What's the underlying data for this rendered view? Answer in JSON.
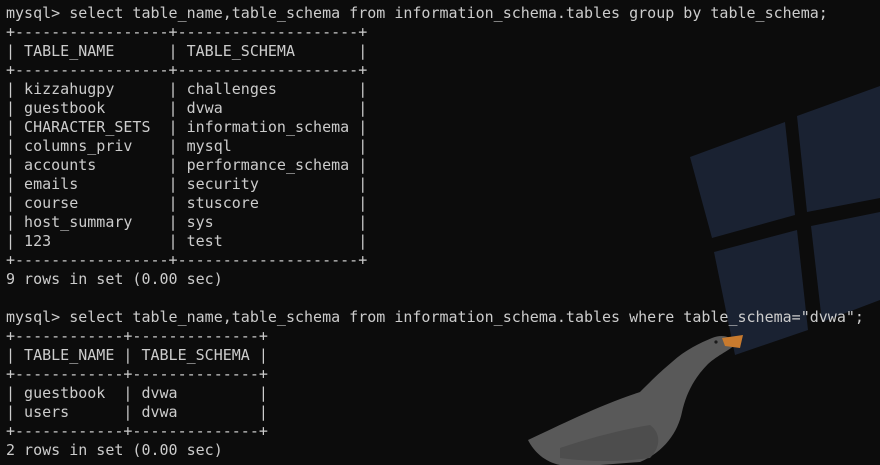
{
  "terminal": {
    "lines": [
      "mysql> select table_name,table_schema from information_schema.tables group by table_schema;",
      "+-----------------+--------------------+",
      "| TABLE_NAME      | TABLE_SCHEMA       |",
      "+-----------------+--------------------+",
      "| kizzahugpy      | challenges         |",
      "| guestbook       | dvwa               |",
      "| CHARACTER_SETS  | information_schema |",
      "| columns_priv    | mysql              |",
      "| accounts        | performance_schema |",
      "| emails          | security           |",
      "| course          | stuscore           |",
      "| host_summary    | sys                |",
      "| 123             | test               |",
      "+-----------------+--------------------+",
      "9 rows in set (0.00 sec)",
      "",
      "mysql> select table_name,table_schema from information_schema.tables where table_schema=\"dvwa\";",
      "+------------+--------------+",
      "| TABLE_NAME | TABLE_SCHEMA |",
      "+------------+--------------+",
      "| guestbook  | dvwa         |",
      "| users      | dvwa         |",
      "+------------+--------------+",
      "2 rows in set (0.00 sec)"
    ]
  },
  "colors": {
    "background": "#0c0c0c",
    "foreground": "#cccccc",
    "wallpaper_window": "#1c2433",
    "wallpaper_goose": "#5e5e5e",
    "goose_beak": "#c87a2e"
  }
}
